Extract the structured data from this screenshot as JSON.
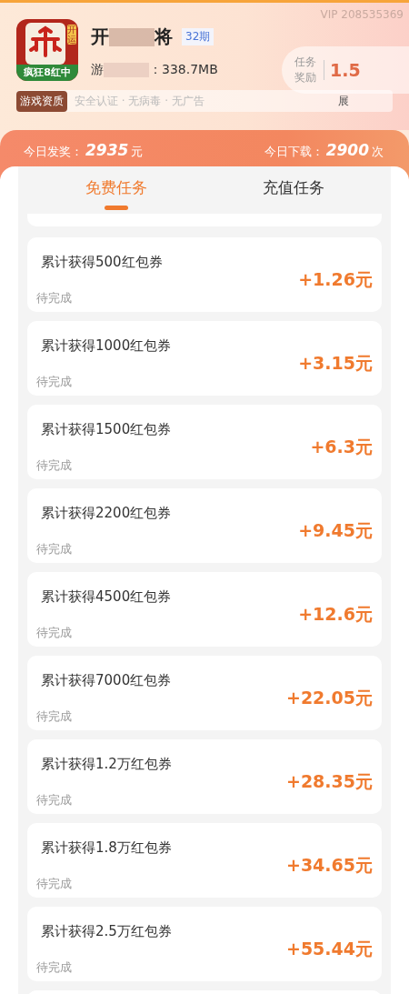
{
  "header": {
    "vip": "VIP 208535369",
    "app_icon_label": "疯狂8红中",
    "app_icon_badge": "开运",
    "title_start": "开",
    "title_end": "将",
    "period": "32期",
    "size_start": "游",
    "size_end": "：338.7MB",
    "reward_label": "任务奖励",
    "reward_value": "1.5",
    "quality_tag": "游戏资质",
    "quality_text": "安全认证 · 无病毒 · 无广告",
    "expand": "展"
  },
  "stats": [
    {
      "label": "今日发奖：",
      "value": "2935",
      "unit": "元"
    },
    {
      "label": "今日下载：",
      "value": "2900",
      "unit": "次"
    }
  ],
  "tabs": [
    {
      "label": "免费任务",
      "selected": true
    },
    {
      "label": "充值任务",
      "selected": false
    }
  ],
  "tasks": [
    {
      "title": "累计获得500红包券",
      "status": "待完成",
      "amount": "+1.26元"
    },
    {
      "title": "累计获得1000红包券",
      "status": "待完成",
      "amount": "+3.15元"
    },
    {
      "title": "累计获得1500红包券",
      "status": "待完成",
      "amount": "+6.3元"
    },
    {
      "title": "累计获得2200红包券",
      "status": "待完成",
      "amount": "+9.45元"
    },
    {
      "title": "累计获得4500红包券",
      "status": "待完成",
      "amount": "+12.6元"
    },
    {
      "title": "累计获得7000红包券",
      "status": "待完成",
      "amount": "+22.05元"
    },
    {
      "title": "累计获得1.2万红包券",
      "status": "待完成",
      "amount": "+28.35元"
    },
    {
      "title": "累计获得1.8万红包券",
      "status": "待完成",
      "amount": "+34.65元"
    },
    {
      "title": "累计获得2.5万红包券",
      "status": "待完成",
      "amount": "+55.44元"
    }
  ]
}
